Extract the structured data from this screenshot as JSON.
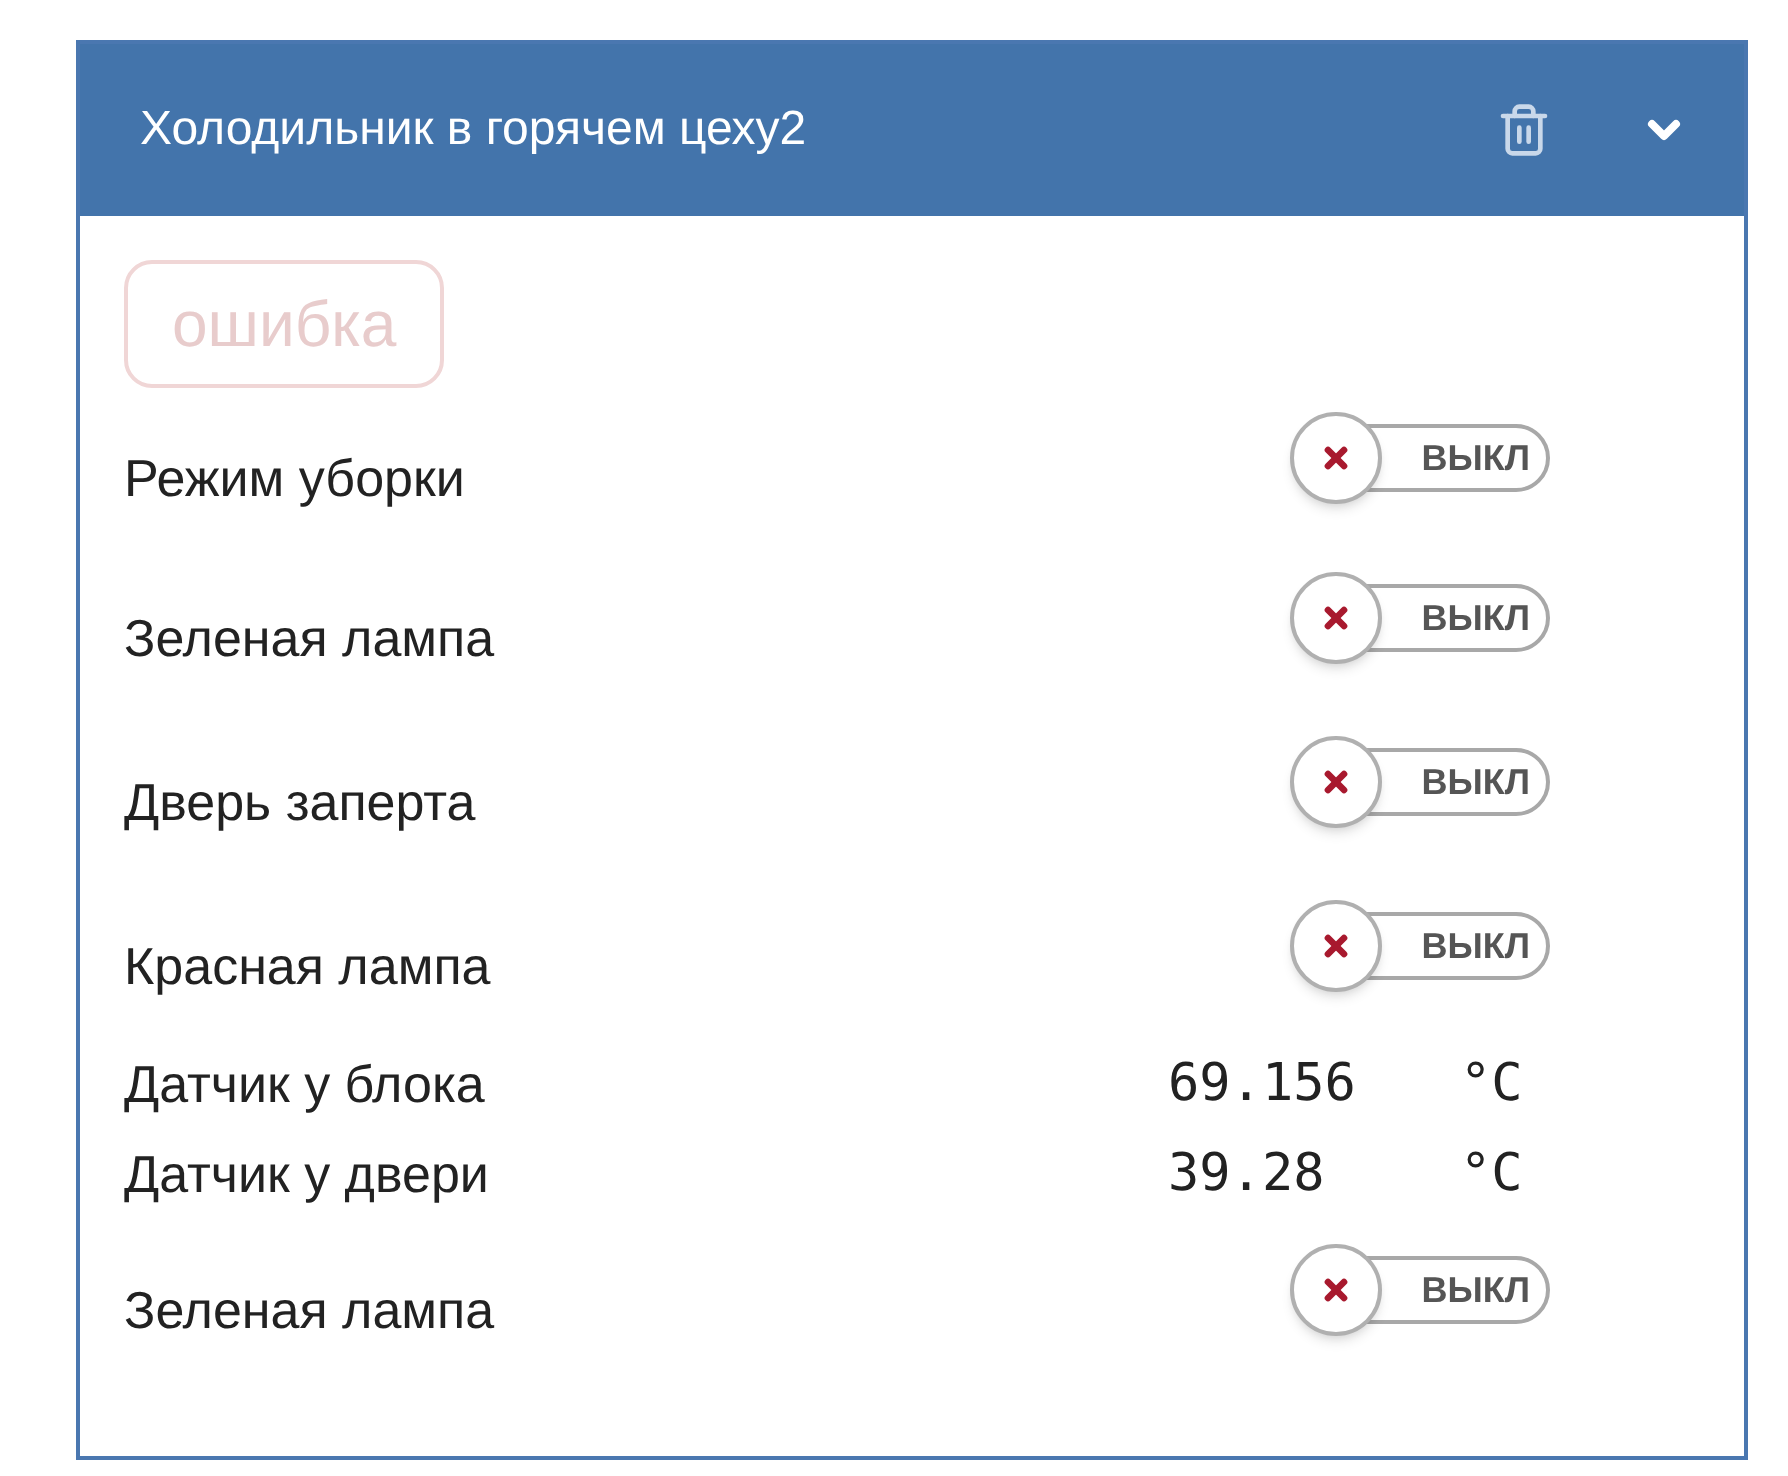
{
  "panel": {
    "title": "Холодильник в горячем цеху2",
    "expanded": true
  },
  "status_badge": {
    "text": "ошибка"
  },
  "rows": [
    {
      "kind": "switch",
      "label": "Режим уборки",
      "on": false,
      "state_text": "ВЫКЛ"
    },
    {
      "kind": "switch",
      "label": "Зеленая лампа",
      "on": false,
      "state_text": "ВЫКЛ"
    },
    {
      "kind": "switch",
      "label": "Дверь заперта",
      "on": false,
      "state_text": "ВЫКЛ"
    },
    {
      "kind": "switch",
      "label": "Красная лампа",
      "on": false,
      "state_text": "ВЫКЛ"
    },
    {
      "kind": "sensor",
      "label": "Датчик у блока",
      "value": "69.156",
      "unit": "°C"
    },
    {
      "kind": "sensor",
      "label": "Датчик у двери",
      "value": "39.28",
      "unit": "°C"
    },
    {
      "kind": "switch",
      "label": "Зеленая лампа",
      "on": false,
      "state_text": "ВЫКЛ"
    }
  ]
}
